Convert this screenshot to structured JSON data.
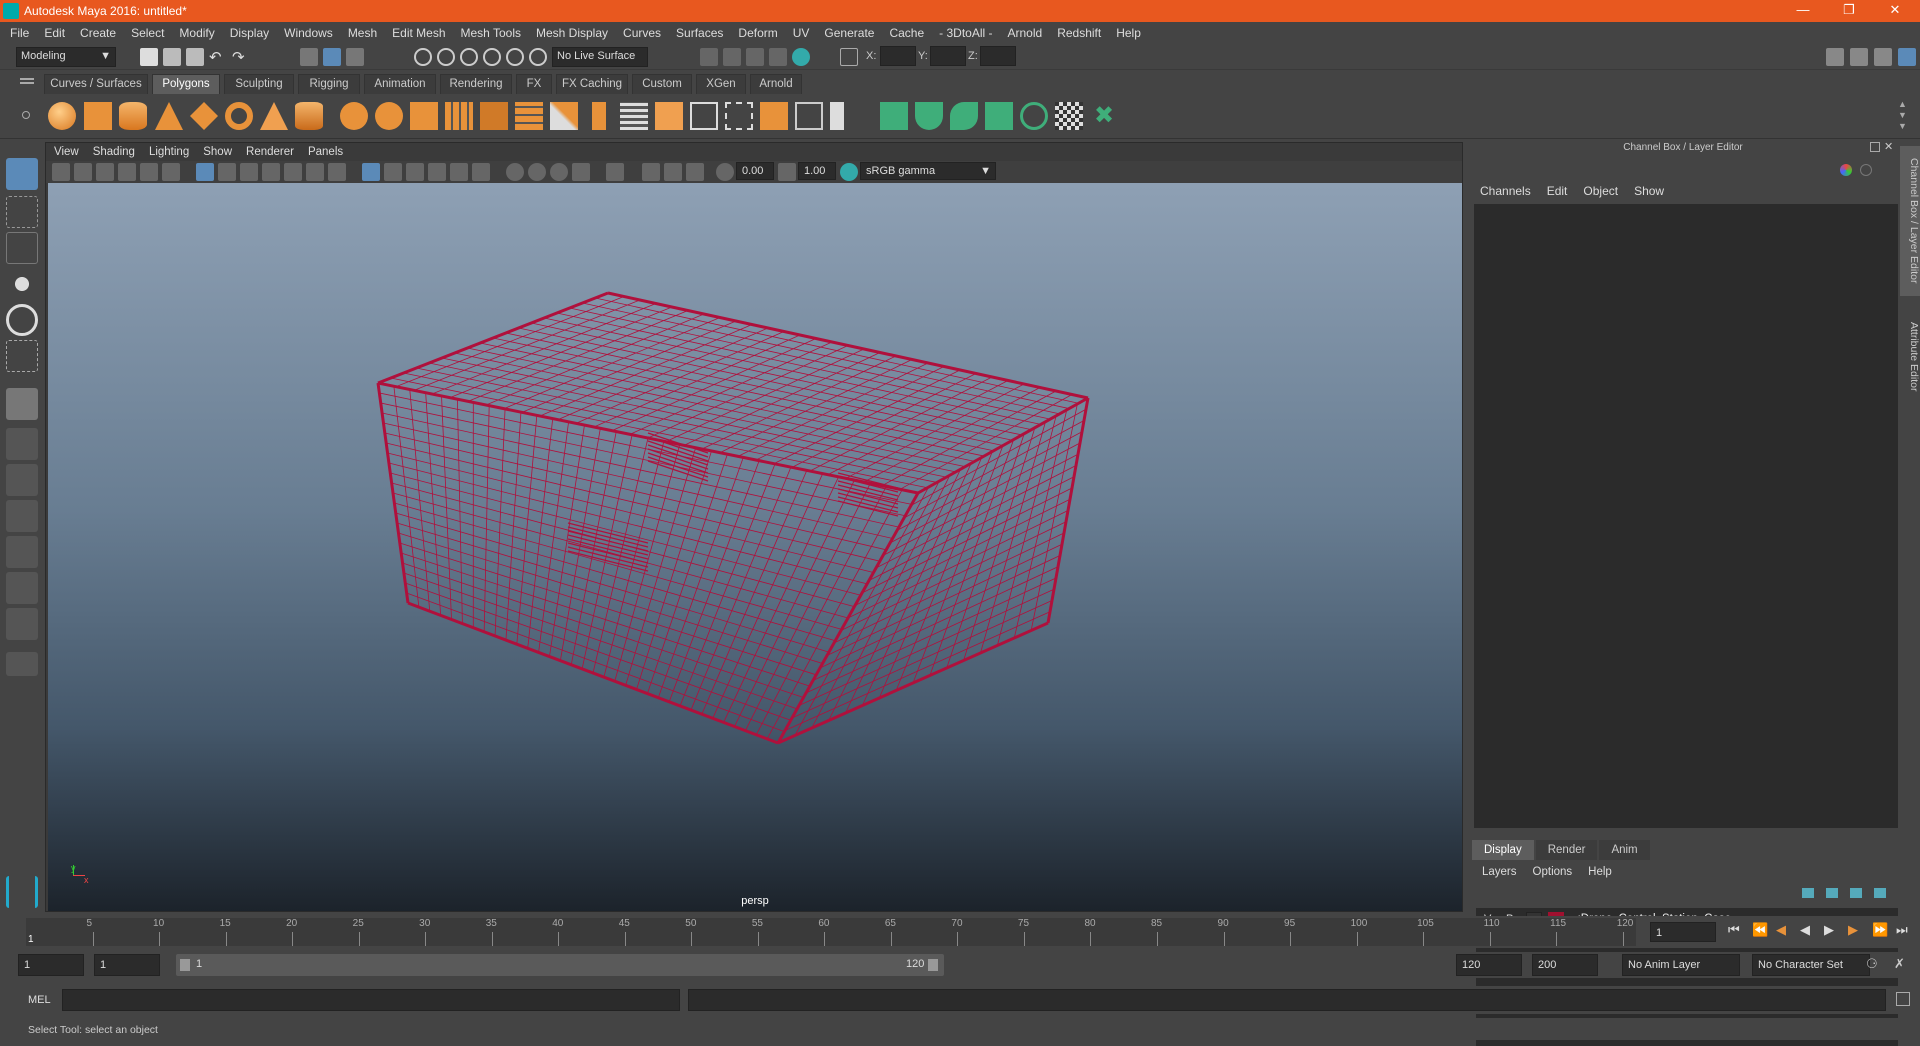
{
  "window": {
    "title": "Autodesk Maya 2016: untitled*"
  },
  "menubar": [
    "File",
    "Edit",
    "Create",
    "Select",
    "Modify",
    "Display",
    "Windows",
    "Mesh",
    "Edit Mesh",
    "Mesh Tools",
    "Mesh Display",
    "Curves",
    "Surfaces",
    "Deform",
    "UV",
    "Generate",
    "Cache",
    "- 3DtoAll -",
    "Arnold",
    "Redshift",
    "Help"
  ],
  "statusline": {
    "mode": "Modeling",
    "live_surface": "No Live Surface",
    "x_label": "X:",
    "y_label": "Y:",
    "z_label": "Z:"
  },
  "shelf_tabs": [
    {
      "label": "Curves / Surfaces",
      "active": false
    },
    {
      "label": "Polygons",
      "active": true
    },
    {
      "label": "Sculpting",
      "active": false
    },
    {
      "label": "Rigging",
      "active": false
    },
    {
      "label": "Animation",
      "active": false
    },
    {
      "label": "Rendering",
      "active": false
    },
    {
      "label": "FX",
      "active": false
    },
    {
      "label": "FX Caching",
      "active": false
    },
    {
      "label": "Custom",
      "active": false
    },
    {
      "label": "XGen",
      "active": false
    },
    {
      "label": "Arnold",
      "active": false
    }
  ],
  "viewport": {
    "menu": [
      "View",
      "Shading",
      "Lighting",
      "Show",
      "Renderer",
      "Panels"
    ],
    "exposure": "0.00",
    "gamma": "1.00",
    "color_space": "sRGB gamma",
    "camera": "persp",
    "axis_y": "y",
    "axis_x": "x",
    "wire_color": "#b0103c"
  },
  "channel_box": {
    "title": "Channel Box / Layer Editor",
    "menu": [
      "Channels",
      "Edit",
      "Object",
      "Show"
    ],
    "tabs": [
      "Display",
      "Render",
      "Anim"
    ],
    "layer_menu": [
      "Layers",
      "Options",
      "Help"
    ],
    "layer": {
      "v": "V",
      "p": "P",
      "name": "...:Drone_Control_Station_Case",
      "color": "#a0102f"
    }
  },
  "side_tabs": [
    "Channel Box / Layer Editor",
    "Attribute Editor"
  ],
  "timeline": {
    "ticks": [
      5,
      10,
      15,
      20,
      25,
      30,
      35,
      40,
      45,
      50,
      55,
      60,
      65,
      70,
      75,
      80,
      85,
      90,
      95,
      100,
      105,
      110,
      115,
      120
    ],
    "start_marker": "1",
    "current_frame": "1"
  },
  "range": {
    "start": "1",
    "playback_start": "1",
    "slider_start": "1",
    "slider_end": "120",
    "playback_end": "120",
    "end": "200",
    "anim_layer": "No Anim Layer",
    "char_set": "No Character Set"
  },
  "cmdline": {
    "label": "MEL"
  },
  "helpline": {
    "text": "Select Tool: select an object"
  }
}
